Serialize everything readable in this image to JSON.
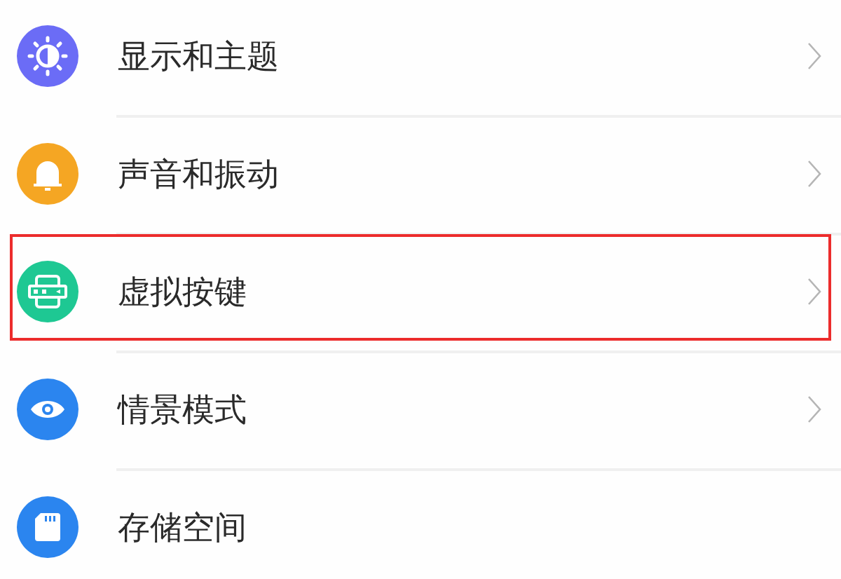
{
  "settings_list": [
    {
      "kind": "display",
      "label": "显示和主题",
      "color": "#6b6cf6",
      "chevron": true,
      "highlighted": false
    },
    {
      "kind": "sound",
      "label": "声音和振动",
      "color": "#f5a623",
      "chevron": true,
      "highlighted": false
    },
    {
      "kind": "keys",
      "label": "虚拟按键",
      "color": "#1ec893",
      "chevron": true,
      "highlighted": true
    },
    {
      "kind": "eye",
      "label": "情景模式",
      "color": "#2b85ef",
      "chevron": true,
      "highlighted": false
    },
    {
      "kind": "storage",
      "label": "存储空间",
      "color": "#2b85ef",
      "chevron": false,
      "highlighted": false
    }
  ]
}
